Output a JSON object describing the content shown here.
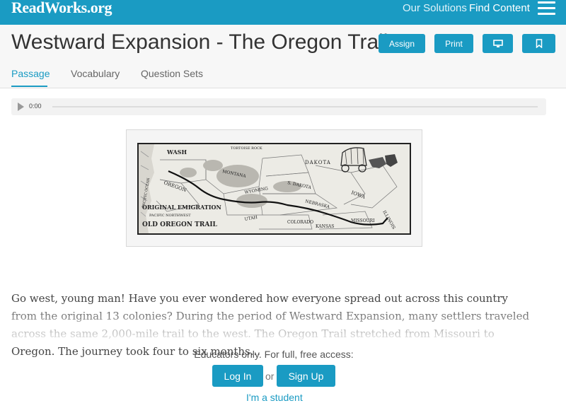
{
  "header": {
    "logo": "ReadWorks.org",
    "nav": {
      "our_solutions": "Our Solutions",
      "find_content": "Find Content"
    }
  },
  "article": {
    "title": "Westward Expansion - The Oregon Trail",
    "actions": {
      "assign": "Assign",
      "print": "Print"
    },
    "tabs": [
      {
        "label": "Passage",
        "active": true
      },
      {
        "label": "Vocabulary",
        "active": false
      },
      {
        "label": "Question Sets",
        "active": false
      }
    ]
  },
  "audio": {
    "time": "0:00"
  },
  "map": {
    "labels": {
      "tortoise_rock": "TORTOISE ROCK",
      "dakota": "DAKOTA",
      "wash": "WASH",
      "oregon": "OREGON",
      "pacific_ocean": "PACIFIC OCEAN",
      "montana": "MONTANA",
      "wyoming": "WYOMING",
      "s_dakota": "S. DAKOTA",
      "nebraska": "NEBRASKA",
      "iowa": "IOWA",
      "illinois": "ILLINOIS",
      "utah": "UTAH",
      "colorado": "COLORADO",
      "kansas": "KANSAS",
      "missouri": "MISSOURI",
      "caption1": "ORIGINAL EMIGRATION",
      "caption2": "PACIFIC NORTHWEST",
      "caption3": "OLD OREGON TRAIL"
    }
  },
  "passage": {
    "text": "Go west, young man!  Have you ever wondered how everyone spread out across this country from the original 13 colonies? During the period of Westward Expansion, many settlers traveled across the same 2,000-mile trail to the west. The Oregon Trail stretched from Missouri to Oregon. The journey took four to six months..."
  },
  "access": {
    "message": "Educators only. For full, free access:",
    "login": "Log In",
    "or": "or",
    "signup": "Sign Up",
    "student": "I'm a student"
  },
  "colors": {
    "brand": "#1a9bc3",
    "title_bar": "#f7f7f7"
  }
}
